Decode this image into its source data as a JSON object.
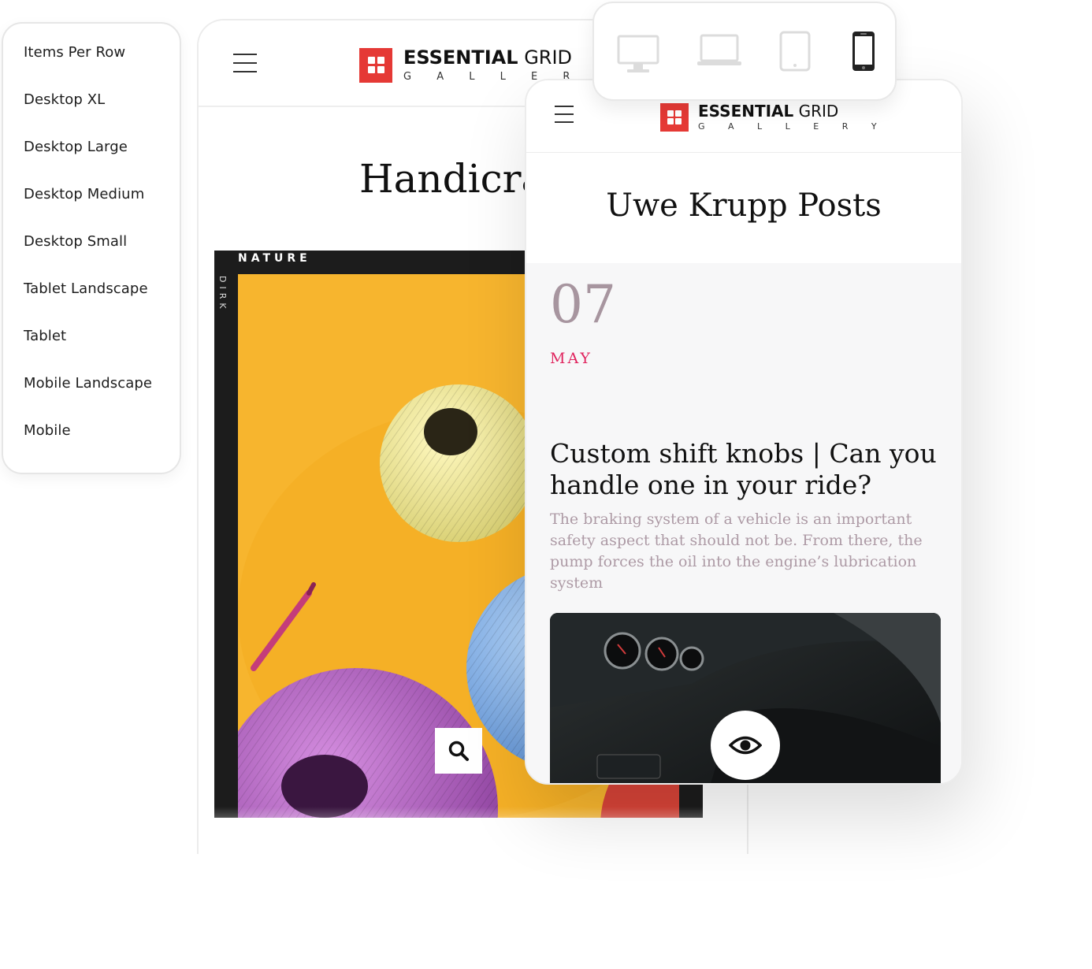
{
  "items_per_row_panel": {
    "items": [
      "Items Per Row",
      "Desktop XL",
      "Desktop Large",
      "Desktop Medium",
      "Desktop Small",
      "Tablet Landscape",
      "Tablet",
      "Mobile Landscape",
      "Mobile"
    ]
  },
  "logo": {
    "bold": "ESSENTIAL",
    "light": "GRID",
    "sub": "G A L L E R Y",
    "brand_color": "#e53935"
  },
  "tablet_preview": {
    "title": "Handicra",
    "card": {
      "tag": "NATURE",
      "side_label": "DIRK",
      "action_icon": "search-icon"
    }
  },
  "mobile_preview": {
    "title": "Uwe Krupp Posts",
    "post": {
      "day": "07",
      "month": "MAY",
      "title": "Custom shift knobs | Can you handle one in your ride?",
      "excerpt": "The braking system of a vehicle is an important safety aspect that should not be. From there, the pump forces the oil into the engine’s lubrication system",
      "action_icon": "eye-icon"
    },
    "colors": {
      "day": "#a7959f",
      "month": "#e0245e",
      "excerpt": "#ad9aa5"
    }
  },
  "device_switcher": {
    "devices": [
      "desktop-icon",
      "laptop-icon",
      "tablet-icon",
      "mobile-icon"
    ],
    "active": "mobile-icon"
  }
}
